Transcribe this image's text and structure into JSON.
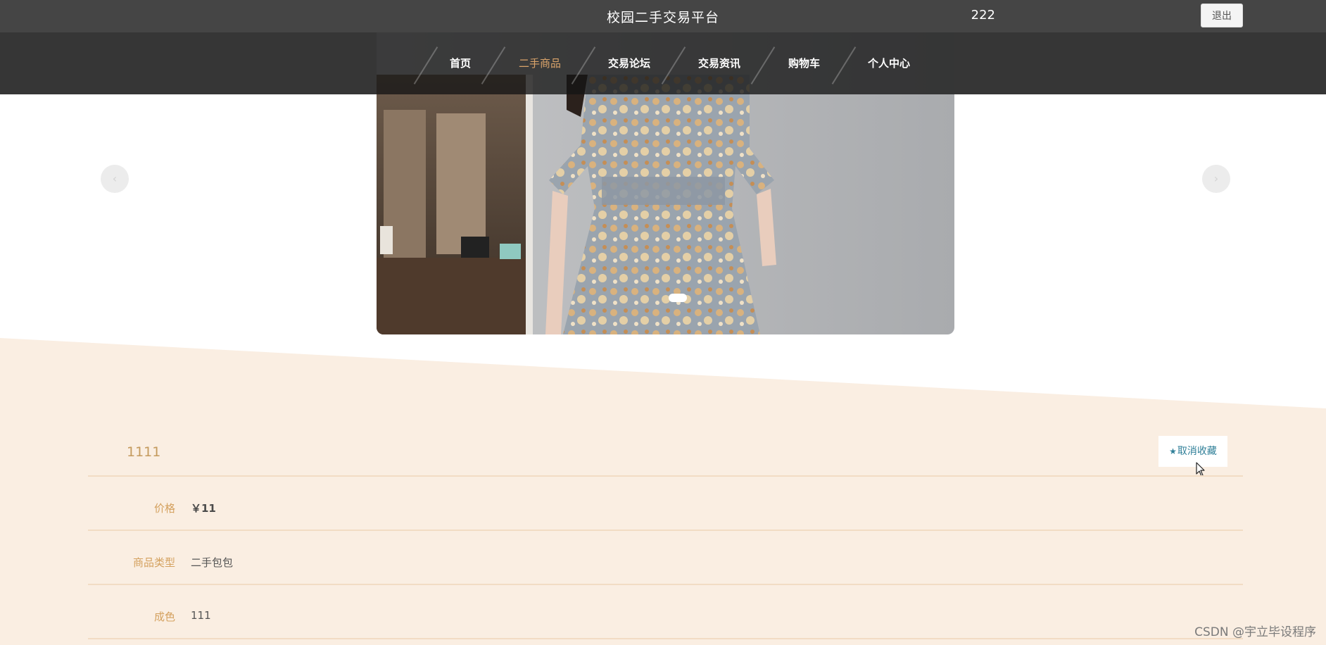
{
  "header": {
    "site_title": "校园二手交易平台",
    "username": "222",
    "logout_label": "退出"
  },
  "nav": {
    "items": [
      {
        "label": "首页",
        "active": false
      },
      {
        "label": "二手商品",
        "active": true
      },
      {
        "label": "交易论坛",
        "active": false
      },
      {
        "label": "交易资讯",
        "active": false
      },
      {
        "label": "购物车",
        "active": false
      },
      {
        "label": "个人中心",
        "active": false
      }
    ]
  },
  "carousel": {
    "prev_icon": "‹",
    "next_icon": "›",
    "slide_count": 1,
    "active_slide": 1
  },
  "product": {
    "title": "1111",
    "favorite_label": "取消收藏",
    "favorite_icon": "★",
    "fields": [
      {
        "label": "价格",
        "value": "￥11",
        "bold": true
      },
      {
        "label": "商品类型",
        "value": "二手包包",
        "bold": false
      },
      {
        "label": "成色",
        "value": "111",
        "bold": false
      }
    ]
  },
  "watermark": "CSDN @宇立毕设程序",
  "colors": {
    "topbar": "#454545",
    "nav_active": "#d9a36a",
    "cream_bg": "#faeee2",
    "label_gold": "#d4a15f",
    "favorite_blue": "#2f7f98"
  }
}
